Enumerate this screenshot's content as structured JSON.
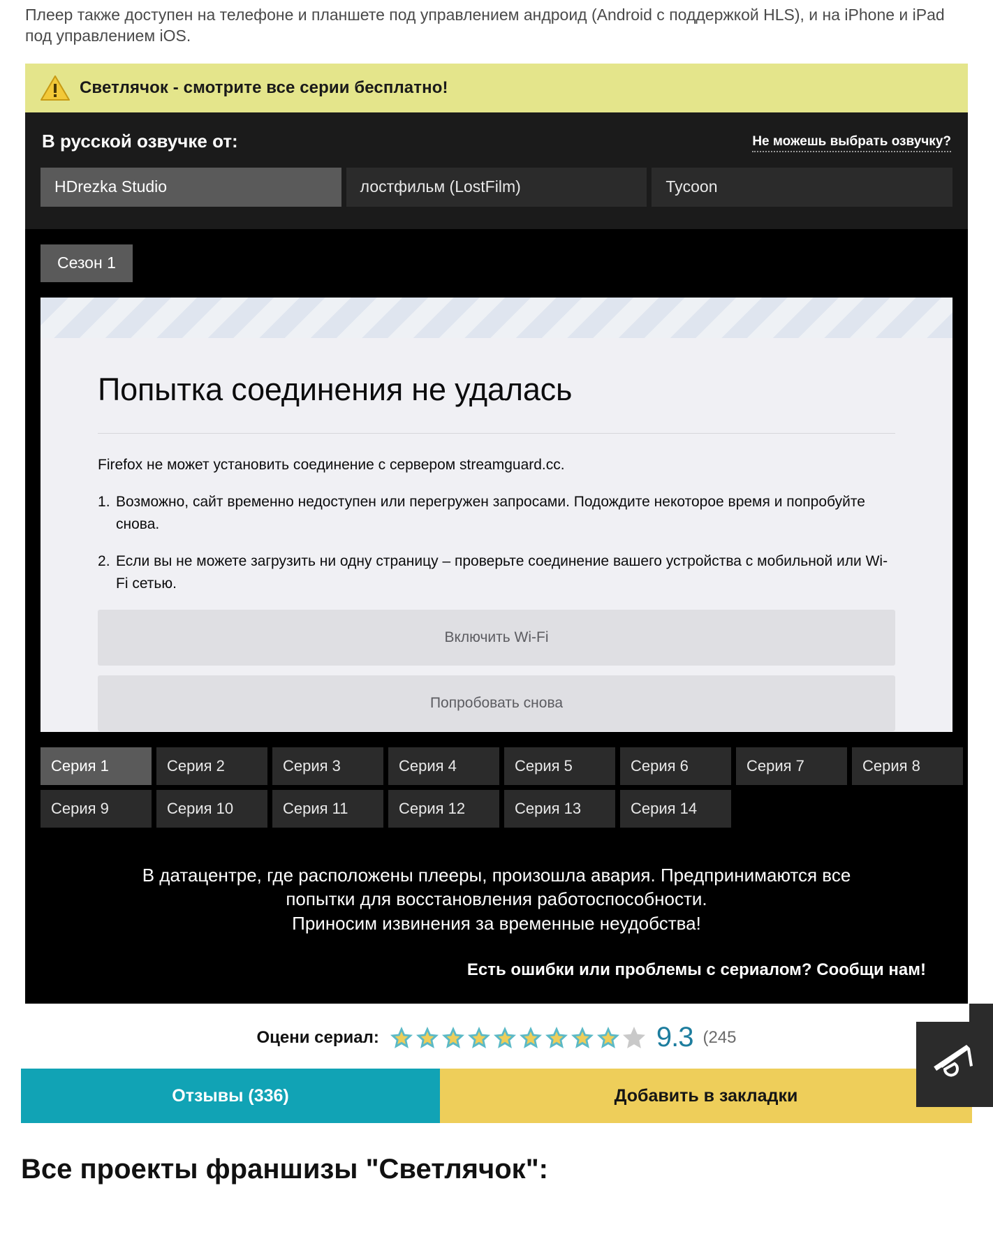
{
  "intro": {
    "text": "Плеер также доступен на телефоне и планшете под управлением андроид (Android с поддержкой HLS), и на iPhone и iPad под управлением iOS."
  },
  "warning_banner": {
    "icon": "warning-triangle-icon",
    "text": "Светлячок - смотрите все серии бесплатно!"
  },
  "dubbing": {
    "title": "В русской озвучке от:",
    "help_link": "Не можешь выбрать озвучку?",
    "tabs": [
      {
        "label": "HDrezka Studio",
        "active": true
      },
      {
        "label": "лостфильм (LostFilm)",
        "active": false
      },
      {
        "label": "Tycoon",
        "active": false
      }
    ]
  },
  "seasons": {
    "tabs": [
      {
        "label": "Сезон 1",
        "active": true
      }
    ]
  },
  "firefox_error": {
    "heading": "Попытка соединения не удалась",
    "description": "Firefox не может установить соединение с сервером streamguard.cc.",
    "reasons": [
      "Возможно, сайт временно недоступен или перегружен запросами. Подождите некоторое время и попробуйте снова.",
      "Если вы не можете загрузить ни одну страницу – проверьте соединение вашего устройства с мобильной или Wi-Fi сетью."
    ],
    "buttons": [
      "Включить Wi-Fi",
      "Попробовать снова"
    ]
  },
  "episodes": {
    "rows": [
      [
        {
          "label": "Серия 1",
          "active": true
        },
        {
          "label": "Серия 2",
          "active": false
        },
        {
          "label": "Серия 3",
          "active": false
        },
        {
          "label": "Серия 4",
          "active": false
        },
        {
          "label": "Серия 5",
          "active": false
        },
        {
          "label": "Серия 6",
          "active": false
        },
        {
          "label": "Серия 7",
          "active": false
        },
        {
          "label": "Серия 8",
          "active": false
        }
      ],
      [
        {
          "label": "Серия 9",
          "active": false
        },
        {
          "label": "Серия 10",
          "active": false
        },
        {
          "label": "Серия 11",
          "active": false
        },
        {
          "label": "Серия 12",
          "active": false
        },
        {
          "label": "Серия 13",
          "active": false
        },
        {
          "label": "Серия 14",
          "active": false
        }
      ]
    ]
  },
  "notice": {
    "line1": "В датацентре, где расположены плееры, произошла авария. Предпринимаются все",
    "line2": "попытки для восстановления работоспособности.",
    "line3": "Приносим извинения за временные неудобства!",
    "report_link": "Есть ошибки или проблемы с сериалом? Сообщи нам!"
  },
  "rating": {
    "label": "Оцени сериал:",
    "stars_total": 10,
    "stars_filled": 9,
    "score": "9.3",
    "votes": "(245",
    "star_fill_color": "#5bb9c6",
    "star_inner_color": "#eece5a",
    "star_empty_color": "#c9c9c9",
    "score_color": "#1d7d9e"
  },
  "cta": {
    "reviews_label": "Отзывы (336)",
    "bookmark_label": "Добавить в закладки",
    "reviews_color": "#11a3b5",
    "bookmark_color": "#eece5a"
  },
  "bottom_heading": "Все проекты франшизы \"Светлячок\":",
  "floating_widget": {
    "icon": "megaphone-icon"
  }
}
